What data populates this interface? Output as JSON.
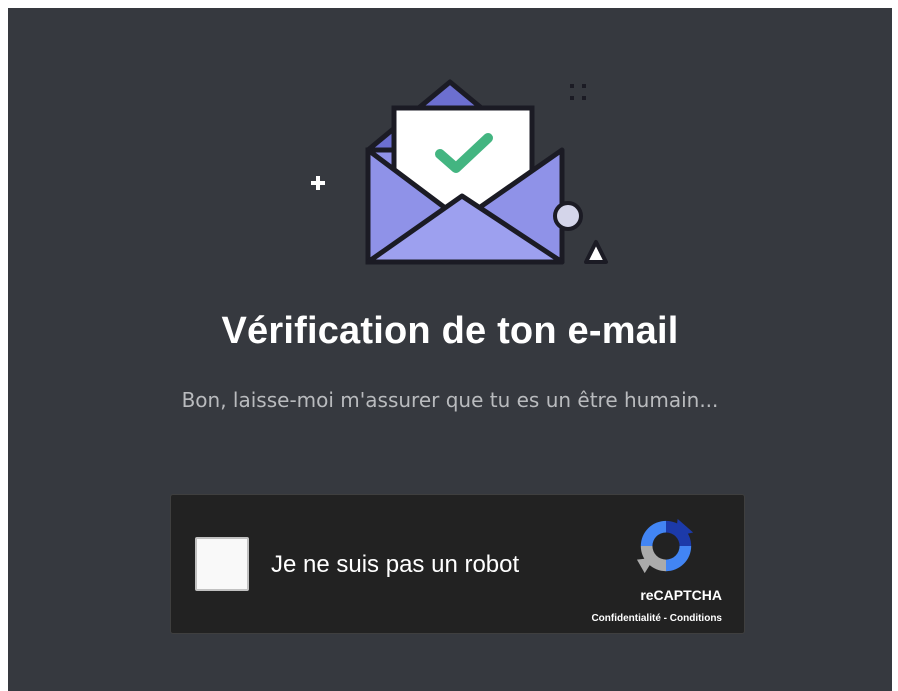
{
  "page": {
    "title": "Vérification de ton e-mail",
    "subtitle": "Bon, laisse-moi m'assurer que tu es un être humain..."
  },
  "illustration": {
    "icon": "envelope-check-icon",
    "colors": {
      "envelope": "#8f92e8",
      "envelope_dark": "#6c6fd0",
      "letter": "#ffffff",
      "check": "#43b581",
      "outline": "#1b1b24"
    }
  },
  "captcha": {
    "label": "Je ne suis pas un robot",
    "brand": "reCAPTCHA",
    "privacy_link": "Confidentialité",
    "separator": " - ",
    "terms_link": "Conditions",
    "checked": false
  },
  "colors": {
    "background": "#36393f",
    "title": "#ffffff",
    "subtitle": "#b9bbbe",
    "captcha_bg": "#222222"
  }
}
